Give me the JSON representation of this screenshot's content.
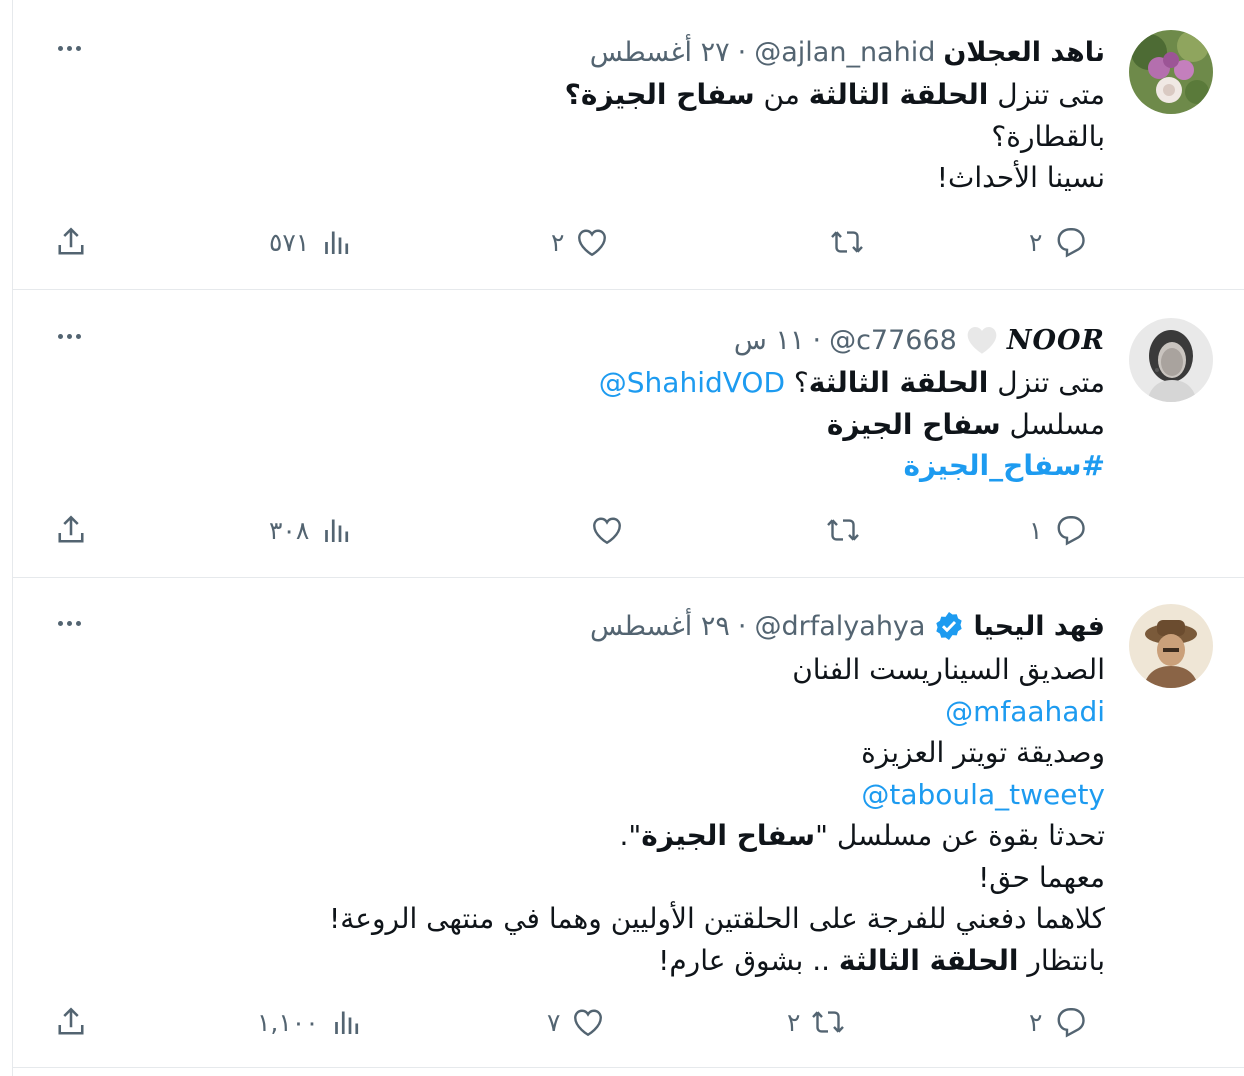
{
  "tweets": [
    {
      "name": "ناهد العجلان",
      "handle": "@ajlan_nahid",
      "separator": "·",
      "time": "٢٧ أغسطس",
      "lines": [
        [
          "متى تنزل ",
          {
            "b": "الحلقة الثالثة"
          },
          " من ",
          {
            "b": "سفاح الجيزة؟"
          }
        ],
        [
          "بالقطارة؟"
        ],
        [
          "نسينا الأحداث!"
        ]
      ],
      "replies": "٢",
      "retweets": "",
      "likes": "٢",
      "views": "٥٧١"
    },
    {
      "name": "NOOR",
      "handle": "@c77668",
      "separator": "·",
      "time": "١١ س",
      "lines": [
        [
          "متى تنزل ",
          {
            "b": "الحلقة الثالثة"
          },
          "؟ ",
          {
            "link": "@ShahidVOD"
          }
        ],
        [
          "مسلسل ",
          {
            "b": "سفاح الجيزة"
          }
        ],
        [
          {
            "linkb": "#سفاح_الجيزة"
          }
        ]
      ],
      "replies": "١",
      "retweets": "",
      "likes": "",
      "views": "٣٠٨"
    },
    {
      "name": "فهد اليحيا",
      "handle": "@drfalyahya",
      "separator": "·",
      "time": "٢٩ أغسطس",
      "lines": [
        [
          "الصديق السيناريست الفنان"
        ],
        [
          {
            "link": "@mfaahadi"
          }
        ],
        [
          "وصديقة تويتر العزيزة"
        ],
        [
          {
            "link": "@taboula_tweety"
          }
        ],
        [
          "تحدثا بقوة عن مسلسل \"",
          {
            "b": "سفاح الجيزة"
          },
          "\"."
        ],
        [
          "معهما حق!"
        ],
        [
          "كلاهما دفعني للفرجة على الحلقتين الأوليين وهما في منتهى الروعة!"
        ],
        [
          "بانتظار ",
          {
            "b": "الحلقة الثالثة"
          },
          " .. بشوق عارم!"
        ]
      ],
      "replies": "٢",
      "retweets": "٢",
      "likes": "٧",
      "views": "١,١٠٠"
    }
  ],
  "colors": {
    "text": "#0f1419",
    "secondary": "#536471",
    "link": "#1d9bf0",
    "border": "#e6e9ec",
    "verified": "#1d9bf0"
  },
  "icons": {
    "more": "more-dots-icon",
    "reply": "reply-icon",
    "retweet": "retweet-icon",
    "like": "heart-icon",
    "views": "views-icon",
    "share": "share-icon",
    "verified": "verified-badge-icon",
    "heart_badge": "white-heart-badge-icon"
  }
}
